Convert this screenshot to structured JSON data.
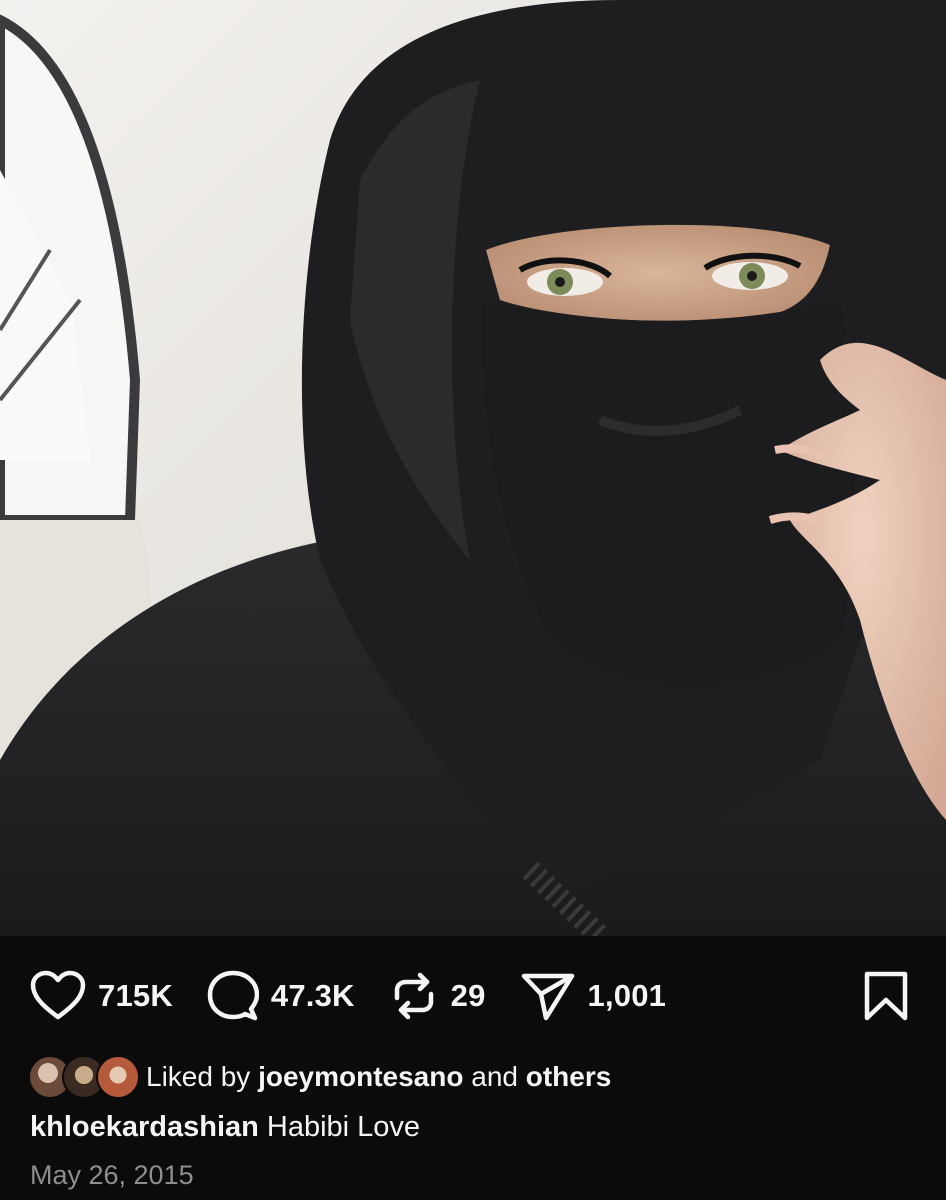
{
  "post": {
    "username": "khloekardashian",
    "caption": "Habibi Love",
    "date": "May 26, 2015"
  },
  "actions": {
    "likes": "715K",
    "comments": "47.3K",
    "reposts": "29",
    "shares": "1,001"
  },
  "liked_by": {
    "prefix": "Liked by",
    "user": "joeymontesano",
    "joiner": "and",
    "others": "others"
  },
  "icons": {
    "like": "heart-icon",
    "comment": "comment-icon",
    "repost": "repost-icon",
    "share": "send-icon",
    "save": "bookmark-icon"
  },
  "colors": {
    "background": "#0b0b0c",
    "text": "#f5f5f5",
    "muted": "#8e8e8e"
  }
}
